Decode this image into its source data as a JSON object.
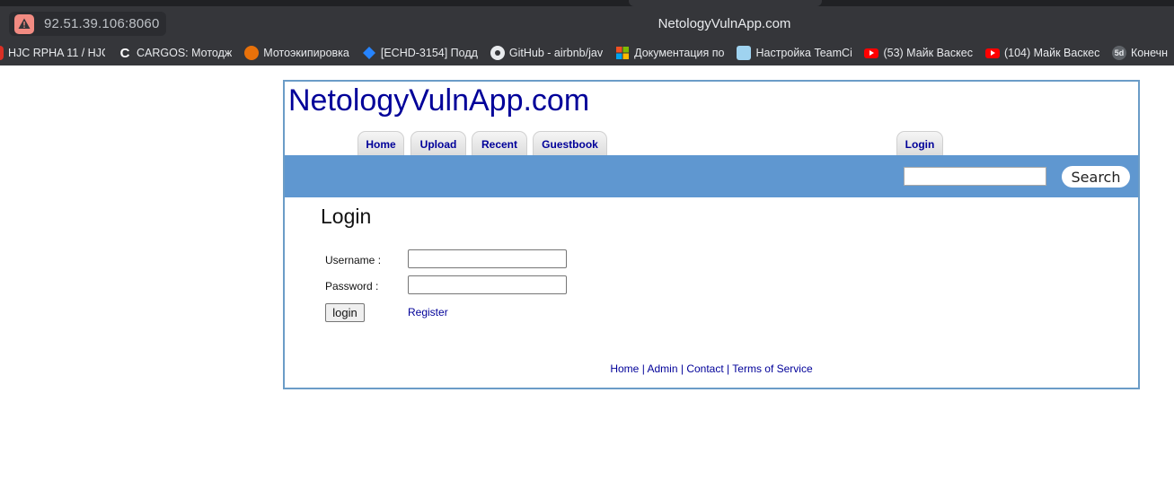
{
  "browser": {
    "address": "92.51.39.106:8060",
    "window_title": "NetologyVulnApp.com",
    "bookmarks": [
      {
        "label": "HJC RPHA 11 / HJC",
        "icon": "partial-icon"
      },
      {
        "label": "CARGOS: Мотодж",
        "icon": "cargos-c-icon"
      },
      {
        "label": "Мотоэкипировка",
        "icon": "moto-shop-icon"
      },
      {
        "label": "[ECHD-3154] Подд",
        "icon": "jira-diamond-icon"
      },
      {
        "label": "GitHub - airbnb/jav",
        "icon": "github-icon"
      },
      {
        "label": "Документация по",
        "icon": "microsoft-icon"
      },
      {
        "label": "Настройка TeamCi",
        "icon": "teamcity-icon"
      },
      {
        "label": "(53) Майк Васкес",
        "icon": "youtube-icon"
      },
      {
        "label": "(104) Майк Васкес",
        "icon": "youtube-icon"
      },
      {
        "label": "Конечн",
        "icon": "5d-icon"
      }
    ]
  },
  "site": {
    "title": "NetologyVulnApp.com",
    "nav": {
      "home": "Home",
      "upload": "Upload",
      "recent": "Recent",
      "guestbook": "Guestbook",
      "login": "Login"
    },
    "search": {
      "button": "Search",
      "value": ""
    }
  },
  "login_form": {
    "heading": "Login",
    "username_label": "Username :",
    "password_label": "Password :",
    "username_value": "",
    "password_value": "",
    "submit_label": "login",
    "register_label": "Register"
  },
  "footer": {
    "home": "Home",
    "admin": "Admin",
    "contact": "Contact",
    "terms": "Terms of Service",
    "separator": "|"
  }
}
